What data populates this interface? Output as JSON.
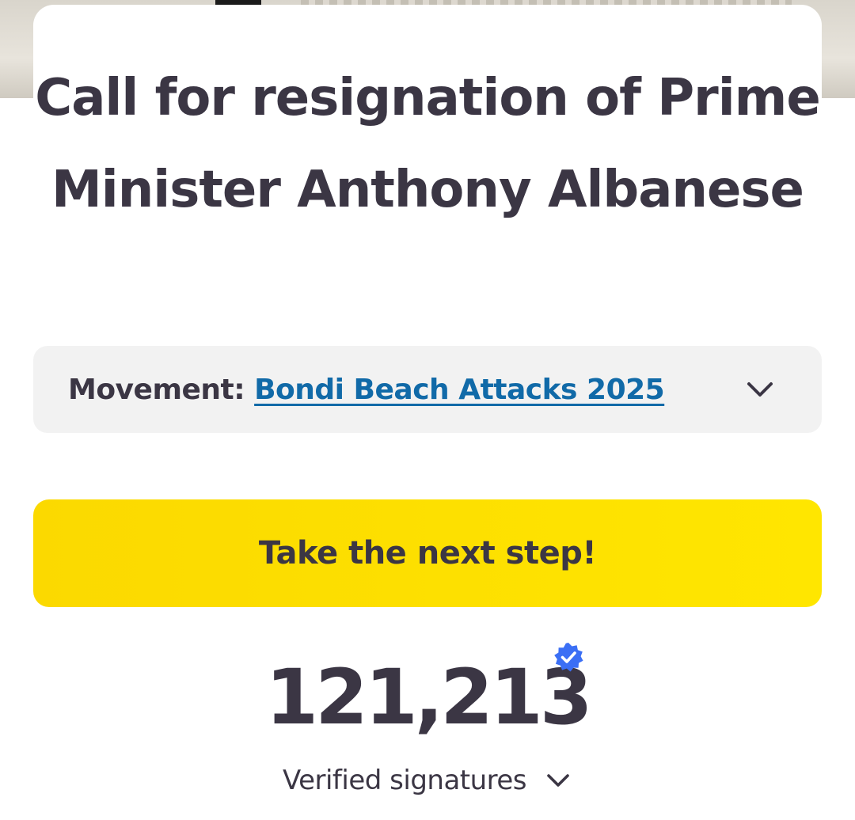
{
  "petition": {
    "title": "Call for resignation of Prime Minister Anthony Albanese"
  },
  "movement": {
    "label": "Movement:",
    "link_text": "Bondi Beach Attacks 2025",
    "icon": "chevron-down-icon"
  },
  "cta": {
    "label": "Take the next step!",
    "color": "#ffe600"
  },
  "signatures": {
    "count": "121,213",
    "label": "Verified signatures",
    "badge_icon": "verified-badge-icon",
    "badge_color": "#3b6ff5"
  },
  "colors": {
    "text": "#3b3644",
    "link": "#116aa8",
    "movement_bg": "#f2f2f2"
  }
}
